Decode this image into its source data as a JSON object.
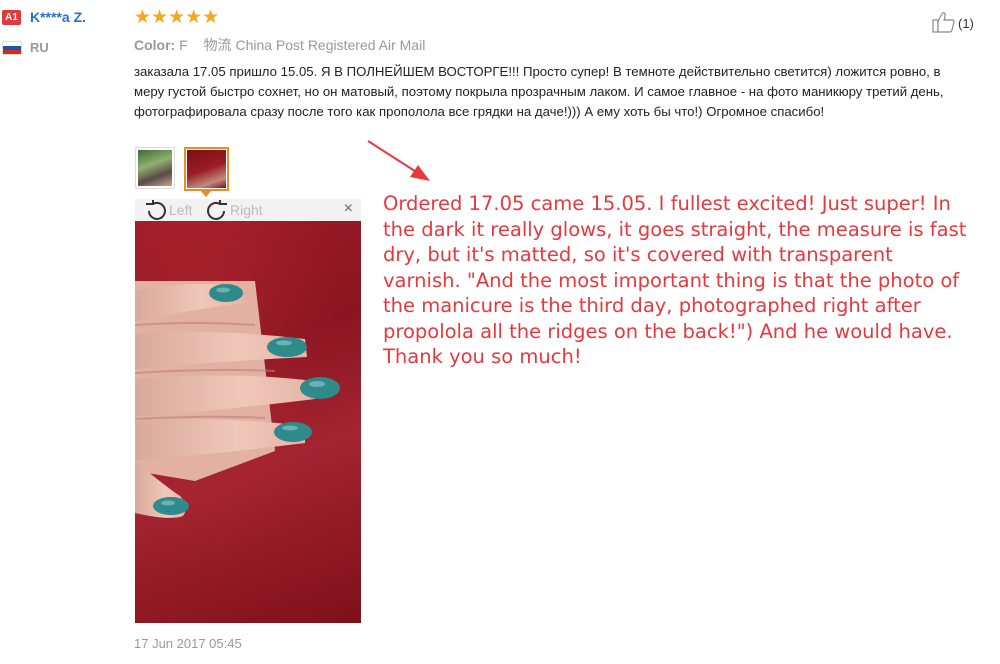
{
  "user": {
    "level_badge": "A1",
    "name": "K****a Z.",
    "country": "RU",
    "flag_colors": [
      "#ffffff",
      "#1c57a5",
      "#d52b1e"
    ]
  },
  "review": {
    "stars": "★★★★★",
    "rating": 5,
    "color_label": "Color:",
    "color_value": "F",
    "shipping_label": "物流",
    "shipping_value": "China Post Registered Air Mail",
    "likes": "(1)",
    "text": "заказала 17.05 пришло 15.05. Я В ПОЛНЕЙШЕМ ВОСТОРГЕ!!! Просто супер! В темноте действительно светится) ложится ровно, в меру густой быстро сохнет, но он матовый, поэтому покрыла прозрачным лаком. И самое главное - на фото маникюру третий день, фотографировала сразу после того как прополола все грядки на даче!))) А ему хоть бы что!) Огромное спасибо!",
    "date": "17 Jun 2017 05:45"
  },
  "viewer": {
    "left_label": "Left",
    "right_label": "Right",
    "close_label": "×"
  },
  "annotation": {
    "text": "Ordered 17.05 came 15.05. I fullest excited! Just super! In the dark it really glows, it goes straight, the measure is fast dry, but it's matted, so it's covered with transparent varnish. \"And the most important thing is that the photo of the manicure is the third day, photographed right after propolola all the ridges on the back!\") And he would have. Thank you so much!",
    "color": "#e8383d"
  },
  "colors": {
    "star": "#f5a623",
    "link": "#2a6fc9",
    "accent": "#f08a24",
    "badge": "#e4393c"
  }
}
